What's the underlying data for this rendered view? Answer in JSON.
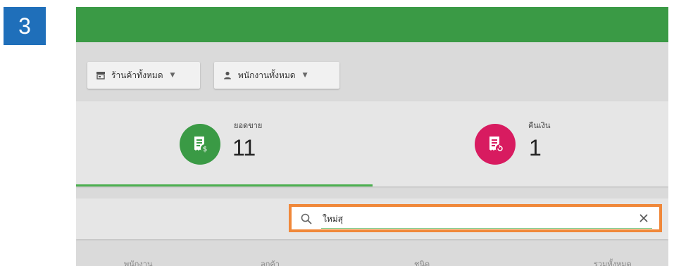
{
  "step_badge": "3",
  "filters": {
    "store": {
      "label": "ร้านค้าทั้งหมด",
      "icon": "store-icon"
    },
    "staff": {
      "label": "พนักงานทั้งหมด",
      "icon": "person-icon"
    }
  },
  "stats": {
    "sales": {
      "label": "ยอดขาย",
      "value": "11",
      "icon": "receipt-dollar-icon",
      "color": "#3a9a45"
    },
    "refund": {
      "label": "คืนเงิน",
      "value": "1",
      "icon": "receipt-refund-icon",
      "color": "#d81b60"
    }
  },
  "search": {
    "value": "ใหม่สุ",
    "icon": "search-icon",
    "clear_icon": "close-icon"
  },
  "table": {
    "headers": [
      "พนักงาน",
      "ลูกค้า",
      "ชนิด",
      "รวมทั้งหมด"
    ]
  },
  "colors": {
    "accent_green": "#3a9a45",
    "highlight_orange": "#f0883a",
    "badge_blue": "#1f6fba"
  }
}
